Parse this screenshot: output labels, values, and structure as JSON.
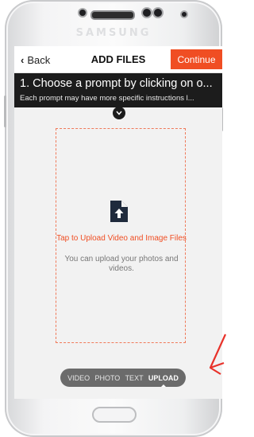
{
  "device": {
    "brand": "SAMSUNG"
  },
  "navbar": {
    "back_label": "Back",
    "title": "ADD FILES",
    "continue_label": "Continue"
  },
  "prompt": {
    "title": "1. Choose a prompt by clicking on o...",
    "subtitle": "Each prompt may have more specific instructions l...",
    "expand_icon": "chevron-down-icon"
  },
  "upload": {
    "icon": "file-upload-icon",
    "tap_text": "Tap to Upload Video and Image Files",
    "sub_text": "You can upload your photos and videos."
  },
  "tabs": [
    {
      "label": "VIDEO",
      "active": false
    },
    {
      "label": "PHOTO",
      "active": false
    },
    {
      "label": "TEXT",
      "active": false
    },
    {
      "label": "UPLOAD",
      "active": true
    }
  ],
  "colors": {
    "accent": "#f04e23",
    "prompt_bar": "#1c1c1c",
    "tab_bar": "#6b6b6b"
  }
}
